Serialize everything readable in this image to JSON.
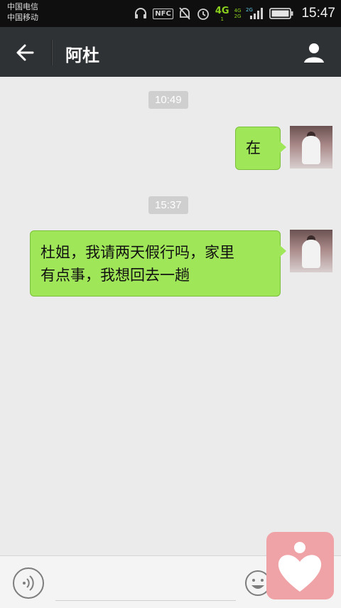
{
  "status_bar": {
    "carrier1": "中国电信",
    "carrier2": "中国移动",
    "nfc": "NFC",
    "net1": "4G",
    "net1_sub": "1",
    "net2_top": "4G",
    "net2_bottom": "2G",
    "time": "15:47"
  },
  "header": {
    "title": "阿杜"
  },
  "messages": [
    {
      "time": "10:49",
      "text": "在"
    },
    {
      "time": "15:37",
      "line1": "杜姐，我请两天假行吗，家里",
      "line2": "有点事，我想回去一趟"
    }
  ],
  "input": {
    "value": "",
    "placeholder": ""
  },
  "colors": {
    "bubble": "#9fe658",
    "app_bar": "#2f3235",
    "background": "#ebebeb",
    "heart_widget": "#f0a3a6"
  }
}
